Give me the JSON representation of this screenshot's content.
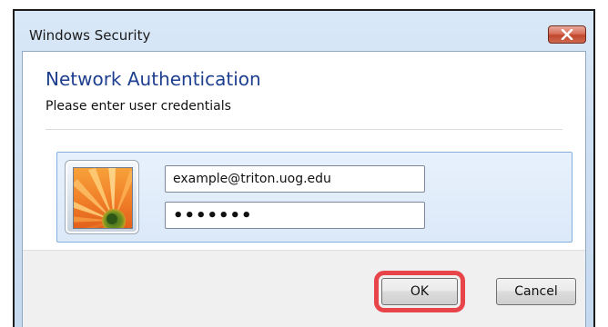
{
  "window": {
    "title": "Windows Security"
  },
  "dialog": {
    "heading": "Network Authentication",
    "subheading": "Please enter user credentials"
  },
  "credentials": {
    "username": "example@triton.uog.edu",
    "password_mask": "•••••••"
  },
  "buttons": {
    "ok_label": "OK",
    "cancel_label": "Cancel"
  },
  "icons": {
    "close": "close-icon",
    "avatar": "user-tile-flower-icon"
  },
  "colors": {
    "heading": "#1e3f8f",
    "highlight": "#e8454b",
    "close_button": "#c0462c",
    "panel_border": "#84acdd"
  }
}
